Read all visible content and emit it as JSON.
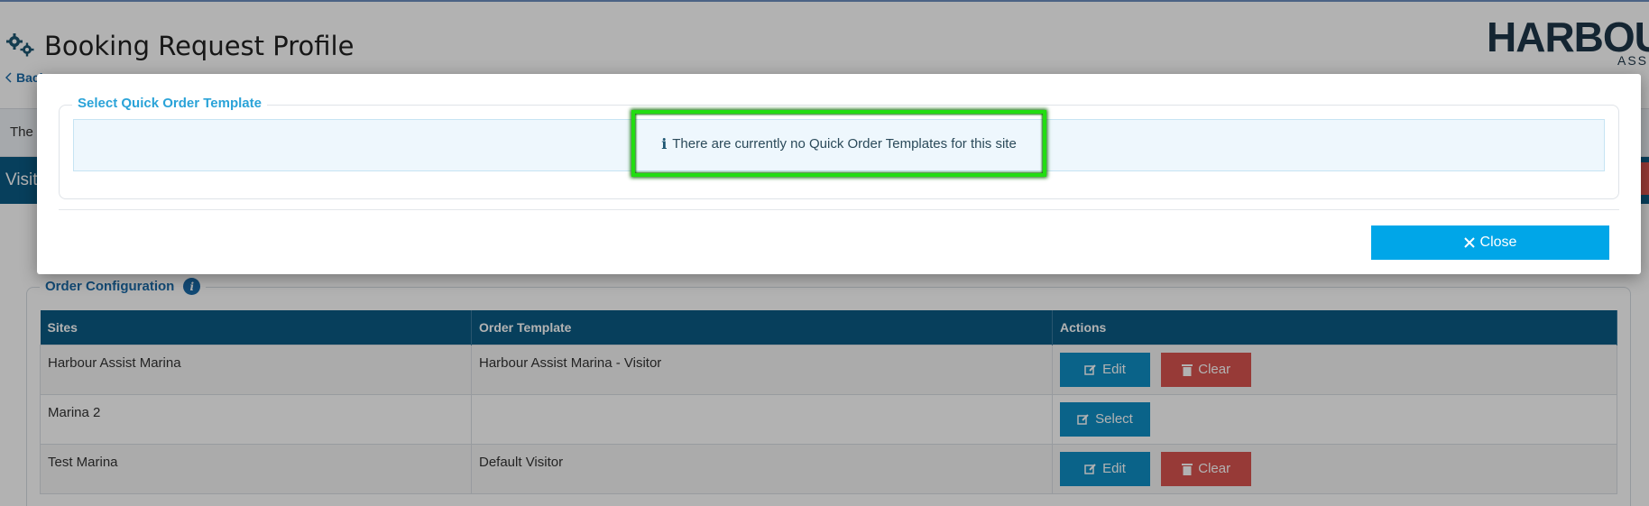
{
  "page": {
    "title": "Booking Request Profile",
    "back_label": "Back",
    "logo_text": "HARBOU",
    "logo_subtext": "ASS",
    "notice_text": "The",
    "tab_label": "Visit",
    "gear_icon": "gear-icon"
  },
  "order_configuration": {
    "legend": "Order Configuration",
    "columns": [
      "Sites",
      "Order Template",
      "Actions"
    ],
    "rows": [
      {
        "site": "Harbour Assist Marina",
        "template": "Harbour Assist Marina - Visitor",
        "actions": [
          "Edit",
          "Clear"
        ]
      },
      {
        "site": "Marina 2",
        "template": "",
        "actions": [
          "Select"
        ]
      },
      {
        "site": "Test Marina",
        "template": "Default Visitor",
        "actions": [
          "Edit",
          "Clear"
        ]
      }
    ],
    "edit_label": "Edit",
    "clear_label": "Clear",
    "select_label": "Select"
  },
  "modal": {
    "legend": "Select Quick Order Template",
    "alert_icon": "info-icon",
    "alert_message": "There are currently no Quick Order Templates for this site",
    "close_label": "Close",
    "close_icon": "close-icon"
  },
  "colors": {
    "primary_dark": "#0b5b84",
    "accent_blue": "#00a6e8",
    "danger": "#d9534f",
    "highlight": "#22dd11"
  }
}
